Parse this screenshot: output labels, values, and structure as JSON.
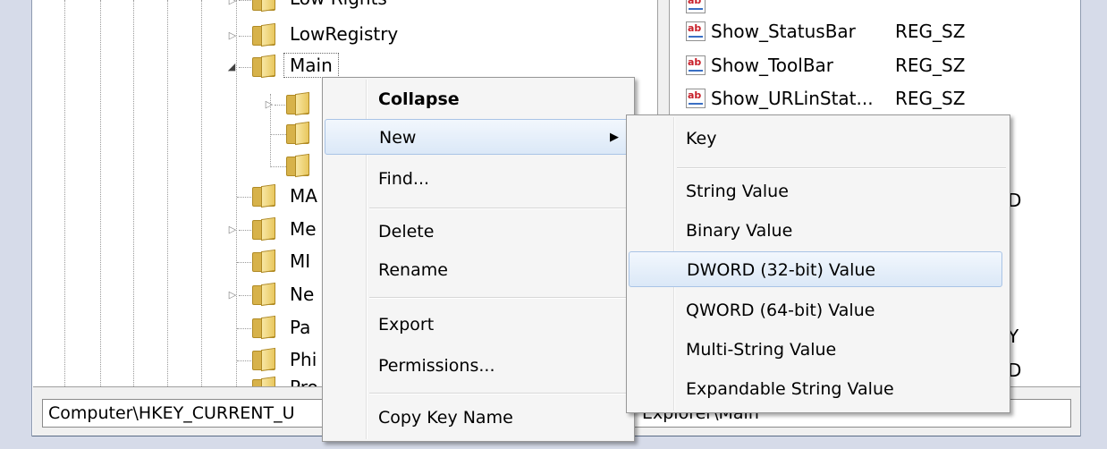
{
  "tree": {
    "items": [
      {
        "label": "Low Rights",
        "expander": "closed"
      },
      {
        "label": "LowRegistry",
        "expander": "closed"
      },
      {
        "label": "Main",
        "expander": "open",
        "selected": true
      },
      {
        "label": "",
        "expander": "closed"
      },
      {
        "label": "",
        "expander": "none"
      },
      {
        "label": "",
        "expander": "none"
      },
      {
        "label": "MA",
        "expander": "none"
      },
      {
        "label": "Me",
        "expander": "closed"
      },
      {
        "label": "MI",
        "expander": "none"
      },
      {
        "label": "Ne",
        "expander": "closed"
      },
      {
        "label": "Pa",
        "expander": "none"
      },
      {
        "label": "Phi",
        "expander": "none"
      },
      {
        "label": "Pro",
        "expander": "none"
      }
    ]
  },
  "values_list": {
    "rows": [
      {
        "name": "Show_StatusBar",
        "type": "REG_SZ",
        "icon": "string-value-icon"
      },
      {
        "name": "Show_ToolBar",
        "type": "REG_SZ",
        "icon": "string-value-icon"
      },
      {
        "name": "Show_URLinStat...",
        "type": "REG_SZ",
        "icon": "string-value-icon"
      }
    ],
    "clipped_right": [
      "D",
      "Y",
      "D"
    ]
  },
  "context_menu": {
    "items": [
      "Collapse",
      "New",
      "Find...",
      "Delete",
      "Rename",
      "Export",
      "Permissions...",
      "Copy Key Name"
    ],
    "submenu_arrow": "▶"
  },
  "new_submenu": {
    "items": [
      "Key",
      "String Value",
      "Binary Value",
      "DWORD (32-bit) Value",
      "QWORD (64-bit) Value",
      "Multi-String Value",
      "Expandable String Value"
    ]
  },
  "statusbar": {
    "path_start": "Computer\\HKEY_CURRENT_U",
    "path_end": "Explorer\\Main"
  }
}
